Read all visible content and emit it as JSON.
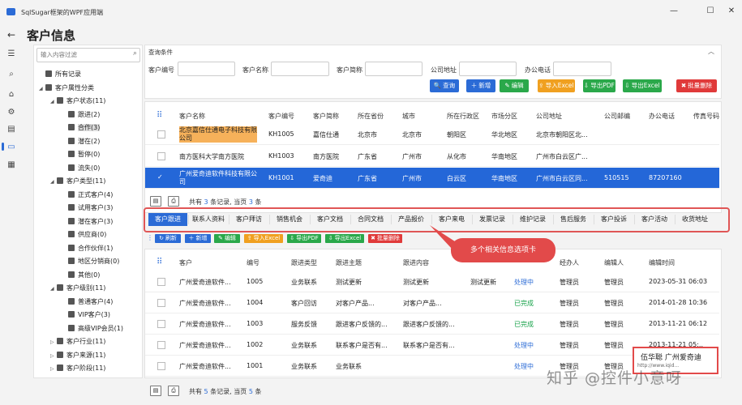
{
  "window": {
    "title": "SqlSugar框架的WPF应用端",
    "buttons": [
      "—",
      "☐",
      "✕"
    ]
  },
  "page": {
    "title": "客户信息",
    "back": "←"
  },
  "rail_icons": [
    "menu-icon",
    "search-icon",
    "home-icon",
    "settings-icon",
    "document-icon",
    "card-icon",
    "grid-icon"
  ],
  "tree": {
    "search_placeholder": "输入内容过滤",
    "items": [
      {
        "label": "所有记录",
        "arrow": "",
        "level": 0
      },
      {
        "label": "客户属性分类",
        "arrow": "◢",
        "level": 0
      },
      {
        "label": "客户状态(11)",
        "arrow": "◢",
        "level": 1
      },
      {
        "label": "跟进(2)",
        "arrow": "",
        "level": 2
      },
      {
        "label": "合作(3)",
        "arrow": "",
        "level": 2
      },
      {
        "label": "潜在(2)",
        "arrow": "",
        "level": 2
      },
      {
        "label": "暂停(0)",
        "arrow": "",
        "level": 2
      },
      {
        "label": "流失(0)",
        "arrow": "",
        "level": 2
      },
      {
        "label": "客户类型(11)",
        "arrow": "◢",
        "level": 1
      },
      {
        "label": "正式客户(4)",
        "arrow": "",
        "level": 2
      },
      {
        "label": "试用客户(3)",
        "arrow": "",
        "level": 2
      },
      {
        "label": "潜在客户(3)",
        "arrow": "",
        "level": 2
      },
      {
        "label": "供应商(0)",
        "arrow": "",
        "level": 2
      },
      {
        "label": "合作伙伴(1)",
        "arrow": "",
        "level": 2
      },
      {
        "label": "地区分销商(0)",
        "arrow": "",
        "level": 2
      },
      {
        "label": "其他(0)",
        "arrow": "",
        "level": 2
      },
      {
        "label": "客户级别(11)",
        "arrow": "◢",
        "level": 1
      },
      {
        "label": "普通客户(4)",
        "arrow": "",
        "level": 2
      },
      {
        "label": "VIP客户(3)",
        "arrow": "",
        "level": 2
      },
      {
        "label": "高级VIP会员(1)",
        "arrow": "",
        "level": 2
      },
      {
        "label": "客户行业(11)",
        "arrow": "▷",
        "level": 1
      },
      {
        "label": "客户来源(11)",
        "arrow": "▷",
        "level": 1
      },
      {
        "label": "客户阶段(11)",
        "arrow": "▷",
        "level": 1
      }
    ]
  },
  "query": {
    "title": "查询条件",
    "collapse": "︿",
    "labels": [
      "客户编号",
      "客户名称",
      "客户简称",
      "公司地址",
      "办公电话"
    ],
    "buttons": [
      {
        "label": "查询",
        "icon": "🔍",
        "color": "#2b6bd6"
      },
      {
        "label": "新增",
        "icon": "＋",
        "color": "#2b6bd6"
      },
      {
        "label": "编辑",
        "icon": "✎",
        "color": "#2aa84a"
      },
      {
        "label": "导入Excel",
        "icon": "⇪",
        "color": "#f0a020"
      },
      {
        "label": "导出PDF",
        "icon": "⇩",
        "color": "#2aa84a"
      },
      {
        "label": "导出Excel",
        "icon": "⇩",
        "color": "#2aa84a"
      },
      {
        "label": "批量删除",
        "icon": "✖",
        "color": "#e03a3a"
      }
    ]
  },
  "grid1": {
    "headers": [
      "客户名称",
      "客户编号",
      "客户简称",
      "所在省份",
      "城市",
      "所在行政区",
      "市场分区",
      "公司地址",
      "公司邮编",
      "办公电话",
      "传真号码"
    ],
    "rows": [
      [
        "北京嘉信仕通电子科技有限公司",
        "KH1005",
        "嘉信仕通",
        "北京市",
        "北京市",
        "朝阳区",
        "华北地区",
        "北京市朝阳区北...",
        "",
        "",
        ""
      ],
      [
        "南方医科大学南方医院",
        "KH1003",
        "南方医院",
        "广东省",
        "广州市",
        "从化市",
        "华南地区",
        "广州市白云区广...",
        "",
        "",
        ""
      ],
      [
        "广州爱奇迪软件科技有限公司",
        "KH1001",
        "爱奇迪",
        "广东省",
        "广州市",
        "白云区",
        "华南地区",
        "广州市白云区同...",
        "510515",
        "87207160",
        ""
      ]
    ],
    "pager": {
      "prefix": "共有",
      "total": "3",
      "mid": "条记录, 当页",
      "page": "3",
      "suffix": "条"
    }
  },
  "tabs": [
    "客户跟进",
    "联系人资料",
    "客户拜访",
    "销售机会",
    "客户文档",
    "合同文档",
    "产品报价",
    "客户来电",
    "发票记录",
    "维护记录",
    "售后服务",
    "客户投诉",
    "客户活动",
    "收货地址"
  ],
  "sub_toolbar": [
    {
      "label": "刷新",
      "icon": "↻",
      "color": "#2b6bd6"
    },
    {
      "label": "新增",
      "icon": "＋",
      "color": "#2b6bd6"
    },
    {
      "label": "编辑",
      "icon": "✎",
      "color": "#2aa84a"
    },
    {
      "label": "导入Excel",
      "icon": "⇪",
      "color": "#f0a020"
    },
    {
      "label": "导出PDF",
      "icon": "⇩",
      "color": "#2aa84a"
    },
    {
      "label": "导出Excel",
      "icon": "⇩",
      "color": "#2aa84a"
    },
    {
      "label": "批量删除",
      "icon": "✖",
      "color": "#e03a3a"
    }
  ],
  "callout": "多个相关信息选项卡",
  "grid2": {
    "headers": [
      "客户",
      "编号",
      "跟进类型",
      "跟进主题",
      "跟进内容",
      "",
      "",
      "经办人",
      "编辑人",
      "编辑时间"
    ],
    "rows": [
      [
        "广州爱奇迪软件...",
        "1005",
        "业务联系",
        "测试更新",
        "测试更新",
        "测试更新",
        "处理中",
        "管理员",
        "管理员",
        "2023-05-31 06:03"
      ],
      [
        "广州爱奇迪软件...",
        "1004",
        "客户回访",
        "对客户产品...",
        "对客户产品...",
        "",
        "已完成",
        "管理员",
        "管理员",
        "2014-01-28 10:36"
      ],
      [
        "广州爱奇迪软件...",
        "1003",
        "服务反馈",
        "跟进客户反馈的...",
        "跟进客户反馈的...",
        "",
        "已完成",
        "管理员",
        "管理员",
        "2013-11-21 06:12"
      ],
      [
        "广州爱奇迪软件...",
        "1002",
        "业务联系",
        "联系客户是否有...",
        "联系客户是否有...",
        "",
        "处理中",
        "管理员",
        "管理员",
        "2013-11-21 05:.."
      ],
      [
        "广州爱奇迪软件...",
        "1001",
        "业务联系",
        "业务联系",
        "",
        "",
        "处理中",
        "管理员",
        "管理员",
        "2013-11-.."
      ]
    ],
    "pager": {
      "prefix": "共有",
      "total": "5",
      "mid": "条记录, 当页",
      "page": "5",
      "suffix": "条"
    }
  },
  "namecard": {
    "line1": "伍华聪 广州爱奇迪",
    "line2": "http://www.iqid..."
  },
  "watermark": "知乎 @控件小意呀"
}
